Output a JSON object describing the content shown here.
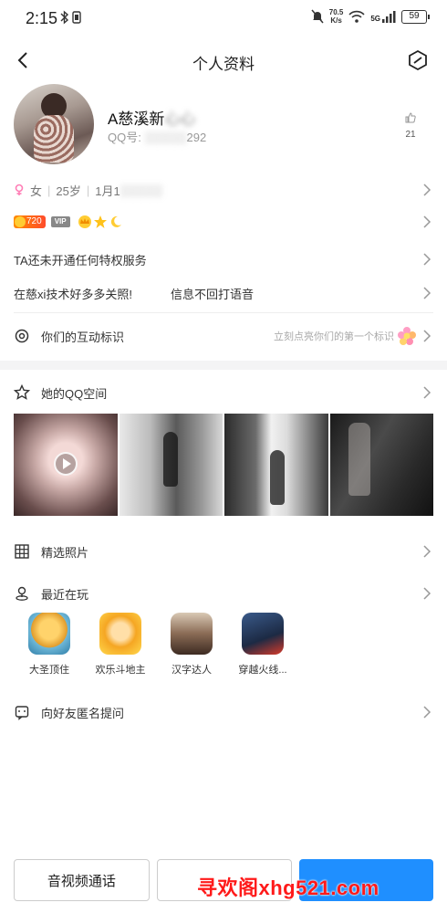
{
  "status_bar": {
    "time": "2:15",
    "net_speed_value": "70.5",
    "net_speed_unit": "K/s",
    "battery": "59",
    "signal_label": "5G"
  },
  "nav": {
    "title": "个人资料"
  },
  "profile": {
    "nickname": "A慈溪新",
    "nickname_blurred": "心心",
    "qq_prefix": "QQ号:",
    "qq_visible": "292",
    "like_count": "21"
  },
  "info": {
    "gender": "女",
    "age": "25岁",
    "birthday": "1月1"
  },
  "badges": {
    "level": "720",
    "vip": "VIP"
  },
  "privilege_text": "TA还未开通任何特权服务",
  "signature": {
    "part_a": "在慈xi技术好多多关照!",
    "part_b": "信息不回打语音"
  },
  "interaction": {
    "label": "你们的互动标识",
    "hint": "立刻点亮你们的第一个标识"
  },
  "qzone": {
    "label": "她的QQ空间"
  },
  "featured_photos": {
    "label": "精选照片"
  },
  "recently_played": {
    "label": "最近在玩",
    "games": [
      {
        "name": "大圣顶住"
      },
      {
        "name": "欢乐斗地主"
      },
      {
        "name": "汉字达人"
      },
      {
        "name": "穿越火线..."
      }
    ]
  },
  "anonymous_ask": {
    "label": "向好友匿名提问"
  },
  "bottom": {
    "call_label": "音视频通话",
    "add_label": "",
    "message_label": ""
  },
  "watermark": "寻欢阁xhg521.com",
  "colors": {
    "primary": "#1f8fff",
    "level_badge": "#ff6a13",
    "watermark": "#ff1a1a"
  }
}
